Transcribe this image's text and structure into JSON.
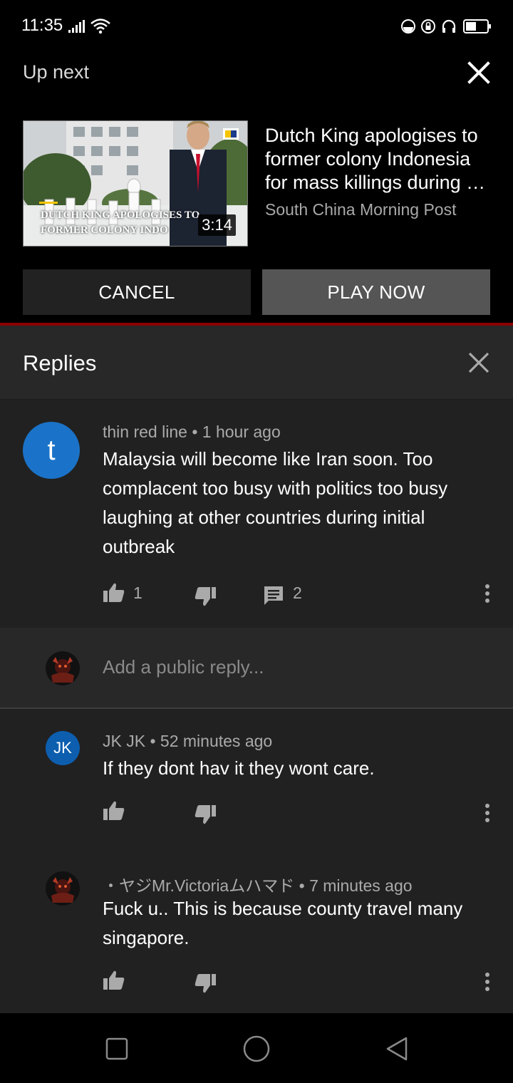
{
  "status_bar": {
    "time": "11:35"
  },
  "up_next": {
    "label": "Up next",
    "video": {
      "title_lines": [
        "Dutch King apologises to",
        "former colony Indonesia",
        "for mass killings during …"
      ],
      "channel": "South China Morning Post",
      "duration": "3:14",
      "thumbnail_caption": [
        "DUTCH KING APOLOGISES TO",
        "FORMER COLONY INDO"
      ]
    },
    "cancel_label": "CANCEL",
    "play_label": "PLAY NOW"
  },
  "replies": {
    "title": "Replies",
    "parent_comment": {
      "avatar_letter": "t",
      "avatar_color": "#1a73c8",
      "author": "thin red line",
      "time": "1 hour ago",
      "text_lines": [
        "Malaysia will become like Iran soon. Too",
        "complacent too busy with politics too busy",
        "laughing at other countries during initial",
        "outbreak"
      ],
      "likes": "1",
      "reply_count": "2"
    },
    "add_reply_placeholder": "Add a public reply...",
    "items": [
      {
        "avatar_letter": "JK",
        "avatar_color": "#0d5eaf",
        "author": "JK JK",
        "time": "52 minutes ago",
        "text_lines": [
          "If they dont hav it they wont care."
        ]
      },
      {
        "author": "・ヤジMr.Victoriaムハマド",
        "time": "7 minutes ago",
        "text_lines": [
          "Fuck u.. This is because county travel many",
          "singapore."
        ]
      }
    ]
  },
  "icons": [
    "signal-icon",
    "wifi-icon",
    "data-saver-icon",
    "lock-rotation-icon",
    "headphones-icon",
    "battery-icon",
    "close-icon",
    "like-icon",
    "dislike-icon",
    "comment-icon",
    "more-vert-icon",
    "recents-icon",
    "home-icon",
    "back-icon"
  ],
  "colors": {
    "background": "#000000",
    "panel": "#212121",
    "accent_red": "#8b0000",
    "play_button": "#555555"
  }
}
